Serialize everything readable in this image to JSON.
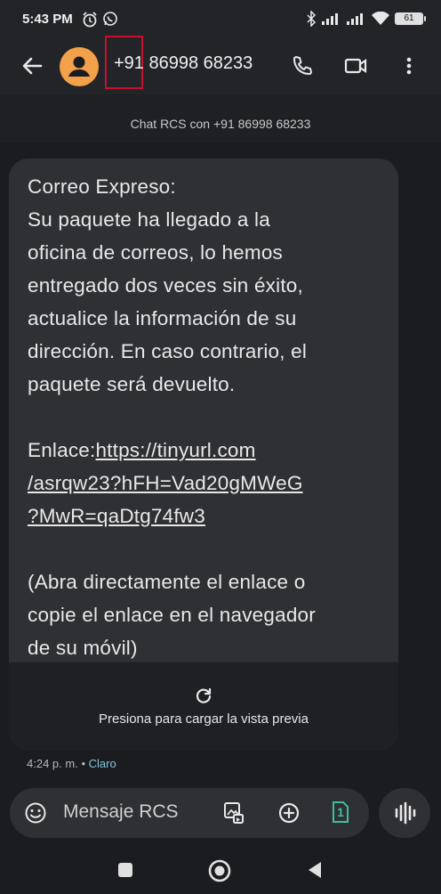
{
  "status": {
    "time": "5:43 PM",
    "battery": "61"
  },
  "header": {
    "contact": "+91 86998 68233"
  },
  "rcs_banner": "Chat RCS con +91 86998 68233",
  "message": {
    "lines": [
      "Correo Expreso:",
      "Su paquete ha llegado a la",
      "oficina de correos, lo hemos",
      "entregado dos veces sin éxito,",
      "actualice la información de su",
      "dirección. En caso contrario, el",
      "paquete será devuelto."
    ],
    "link_label": "Enlace:",
    "link_lines": [
      "https://tinyurl.com",
      "/asrqw23?hFH=Vad20gMWeG",
      "?MwR=qaDtg74fw3"
    ],
    "footer_lines": [
      "(Abra directamente el enlace o",
      "copie el enlace en el navegador",
      "de su móvil)"
    ],
    "preview_text": "Presiona para cargar la vista previa"
  },
  "meta": {
    "time": "4:24 p. m.",
    "separator": "•",
    "carrier": "Claro"
  },
  "composer": {
    "placeholder": "Mensaje RCS",
    "sim": "1"
  },
  "icons": {
    "back": "arrow-left-icon",
    "avatar": "person-icon",
    "call": "phone-icon",
    "video": "video-icon",
    "more": "more-vert-icon",
    "emoji": "emoji-icon",
    "gallery": "gallery-icon",
    "add": "add-circle-icon",
    "voice": "waveform-icon"
  }
}
